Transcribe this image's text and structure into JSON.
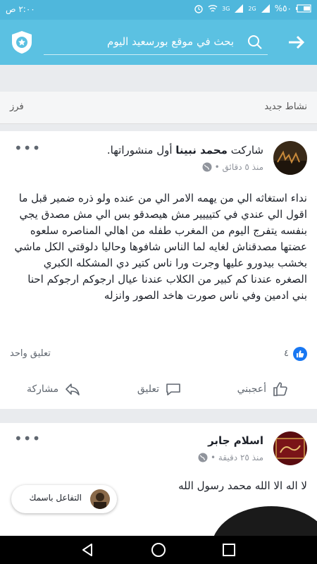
{
  "status_bar": {
    "time": "٢:٠٠ ص",
    "battery": "%٥٠",
    "network": "3G",
    "network2": "2G"
  },
  "app_bar": {
    "search_placeholder": "بحث في موقع بورسعيد اليوم"
  },
  "activity": {
    "new_activity": "نشاط جديد",
    "sort": "فرز"
  },
  "post1": {
    "author": "محمد نبينا",
    "action_prefix": "شاركت ",
    "action_suffix": " أول منشوراتها.",
    "time": "منذ ٥ دقائق •",
    "body": "نداء استغاثه الي من يهمه الامر الي من عنده ولو ذره ضمير قبل ما اقول الي عندي في كتيييير مش هيصدقو بس الي مش مصدق يجي بنفسه يتفرج اليوم من المغرب طفله من اهالي المناصره سلعوه عضتها مصدقناش لغايه لما الناس شافوها وحاليا دلوقتي الكل ماشي بخشب بيدورو عليها وجرت ورا ناس كتير دي المشكله الكبري الصغره عندنا كم كبير من الكلاب عندنا عيال ارجوكم ارجوكم احنا بني ادمين وفي ناس صورت هاخد الصور وانزله",
    "like_count": "٤",
    "comment_count": "تعليق واحد",
    "actions": {
      "like": "أعجبني",
      "comment": "تعليق",
      "share": "مشاركة"
    }
  },
  "post2": {
    "author": "اسلام جابر",
    "time": "منذ ٢٥ دقيقة •",
    "body": "لا اله الا الله محمد رسول الله"
  },
  "react_as": {
    "label": "التفاعل باسمك"
  },
  "colors": {
    "status_bar": "#4fb7dc",
    "app_bar": "#5bc1e2",
    "like_blue": "#1877f2"
  }
}
